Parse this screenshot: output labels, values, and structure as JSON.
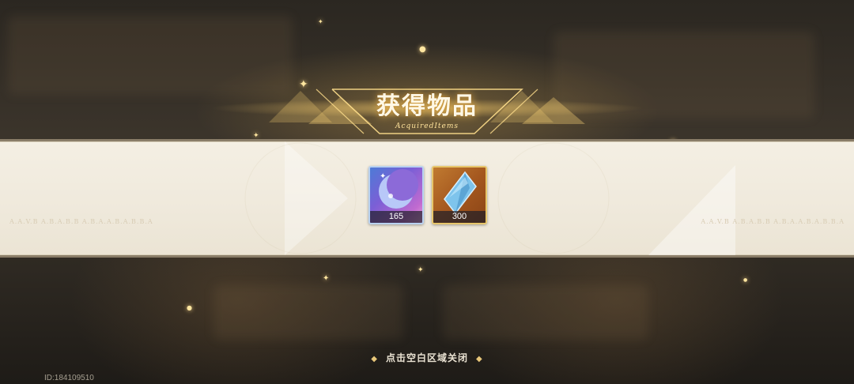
{
  "header": {
    "title": "获得物品",
    "subtitle": "AcquiredItems"
  },
  "panel": {
    "deco_left": "A.A.V.B A.B.A.B.B A.B.A.A.B.A.B.B.A",
    "deco_right": "A.A.V.B A.B.A.B.B A.B.A.A.B.A.B.B.A"
  },
  "items": [
    {
      "icon": "crescent-moon-icon",
      "count": "165",
      "rarity_color": "#7b5fd6"
    },
    {
      "icon": "blue-crystal-icon",
      "count": "300",
      "rarity_color": "#e7c66b"
    }
  ],
  "footer": {
    "close_hint": "点击空白区域关闭",
    "uid": "ID:184109510"
  },
  "colors": {
    "accent_gold": "#e8c77a",
    "panel_bg": "#f0eadd"
  }
}
